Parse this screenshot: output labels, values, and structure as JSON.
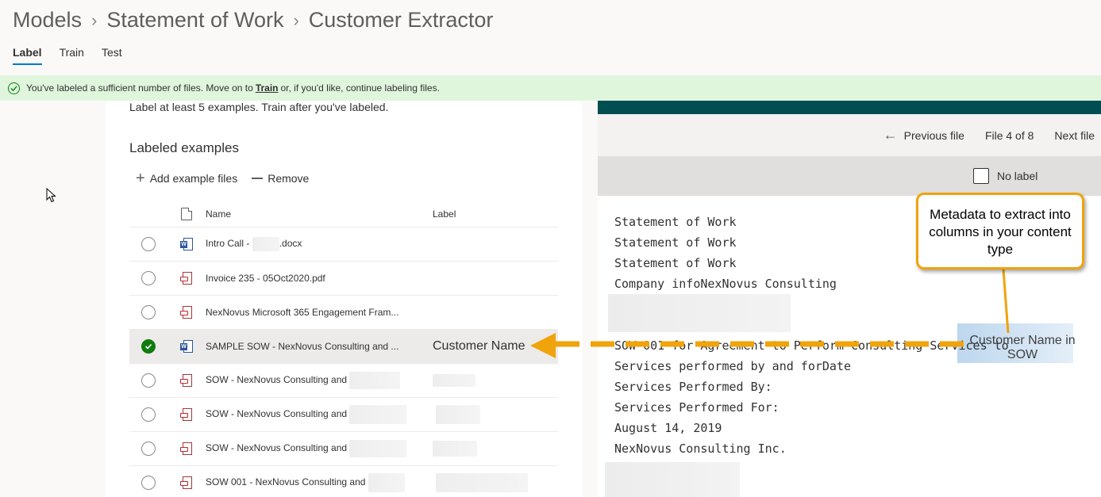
{
  "breadcrumb": [
    "Models",
    "Statement of Work",
    "Customer Extractor"
  ],
  "tabs": [
    "Label",
    "Train",
    "Test"
  ],
  "active_tab": "Label",
  "banner": {
    "prefix": "You've labeled a sufficient number of files. Move on to",
    "link": "Train",
    "suffix": "or, if you'd like, continue labeling files."
  },
  "left_panel": {
    "hint": "Label at least 5 examples. Train after you've labeled.",
    "title": "Labeled examples",
    "add_label": "Add example files",
    "remove_label": "Remove",
    "columns": {
      "name": "Name",
      "label": "Label"
    },
    "rows": [
      {
        "name": "Intro Call - ",
        "name_suffix": ".docx",
        "icon": "word-document-icon",
        "label": "",
        "selected": false
      },
      {
        "name": "Invoice 235 - 05Oct2020.pdf",
        "icon": "pdf-document-icon",
        "label": "",
        "selected": false
      },
      {
        "name": "NexNovus Microsoft 365 Engagement Fram...",
        "icon": "pdf-document-icon",
        "label": "",
        "selected": false
      },
      {
        "name": "SAMPLE SOW - NexNovus Consulting and ...",
        "icon": "word-document-icon",
        "label": "Customer Name",
        "selected": true
      },
      {
        "name": "SOW - NexNovus Consulting and",
        "icon": "pdf-document-icon",
        "label": "",
        "selected": false
      },
      {
        "name": "SOW - NexNovus Consulting and",
        "icon": "pdf-document-icon",
        "label": "",
        "selected": false
      },
      {
        "name": "SOW - NexNovus Consulting and",
        "icon": "pdf-document-icon",
        "label": "",
        "selected": false
      },
      {
        "name": "SOW 001 - NexNovus Consulting and",
        "icon": "pdf-document-icon",
        "label": "",
        "selected": false
      }
    ]
  },
  "viewer": {
    "previous": "Previous file",
    "file_position": "File 4 of 8",
    "next": "Next file",
    "no_label": "No label",
    "doc_lines": [
      "Statement of Work",
      "Statement of Work",
      "Statement of Work",
      "Company infoNexNovus Consulting",
      "",
      "SOW 001 for Agreement to Perform Consulting Services to",
      "Services performed by and forDate",
      "Services Performed By:",
      "Services Performed For:",
      "August 14, 2019",
      "NexNovus Consulting Inc."
    ]
  },
  "annotations": {
    "callout": "Metadata to extract into columns in your content type",
    "highlight_label": "Customer Name in SOW"
  },
  "colors": {
    "accent": "#0078d4",
    "success": "#107c10",
    "banner_bg": "#dff6dd",
    "callout": "#f0a30a",
    "viewer_header": "#004e51"
  }
}
